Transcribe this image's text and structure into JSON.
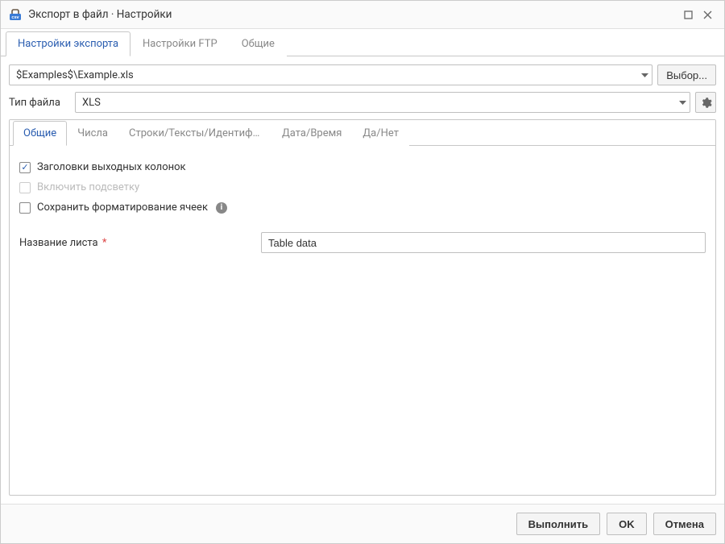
{
  "window": {
    "title": "Экспорт в файл · Настройки"
  },
  "main_tabs": {
    "export_settings": "Настройки экспорта",
    "ftp_settings": "Настройки FTP",
    "general": "Общие"
  },
  "file": {
    "path": "$Examples$\\Example.xls",
    "choose_label": "Выбор..."
  },
  "filetype": {
    "label": "Тип файла",
    "value": "XLS"
  },
  "inner_tabs": {
    "general": "Общие",
    "numbers": "Числа",
    "strings": "Строки/Тексты/Идентифик...",
    "datetime": "Дата/Время",
    "yesno": "Да/Нет"
  },
  "options": {
    "headers": "Заголовки выходных колонок",
    "highlight": "Включить подсветку",
    "keep_format": "Сохранить форматирование ячеек"
  },
  "sheet": {
    "label": "Название листа",
    "value": "Table data"
  },
  "footer": {
    "run": "Выполнить",
    "ok": "OK",
    "cancel": "Отмена"
  }
}
